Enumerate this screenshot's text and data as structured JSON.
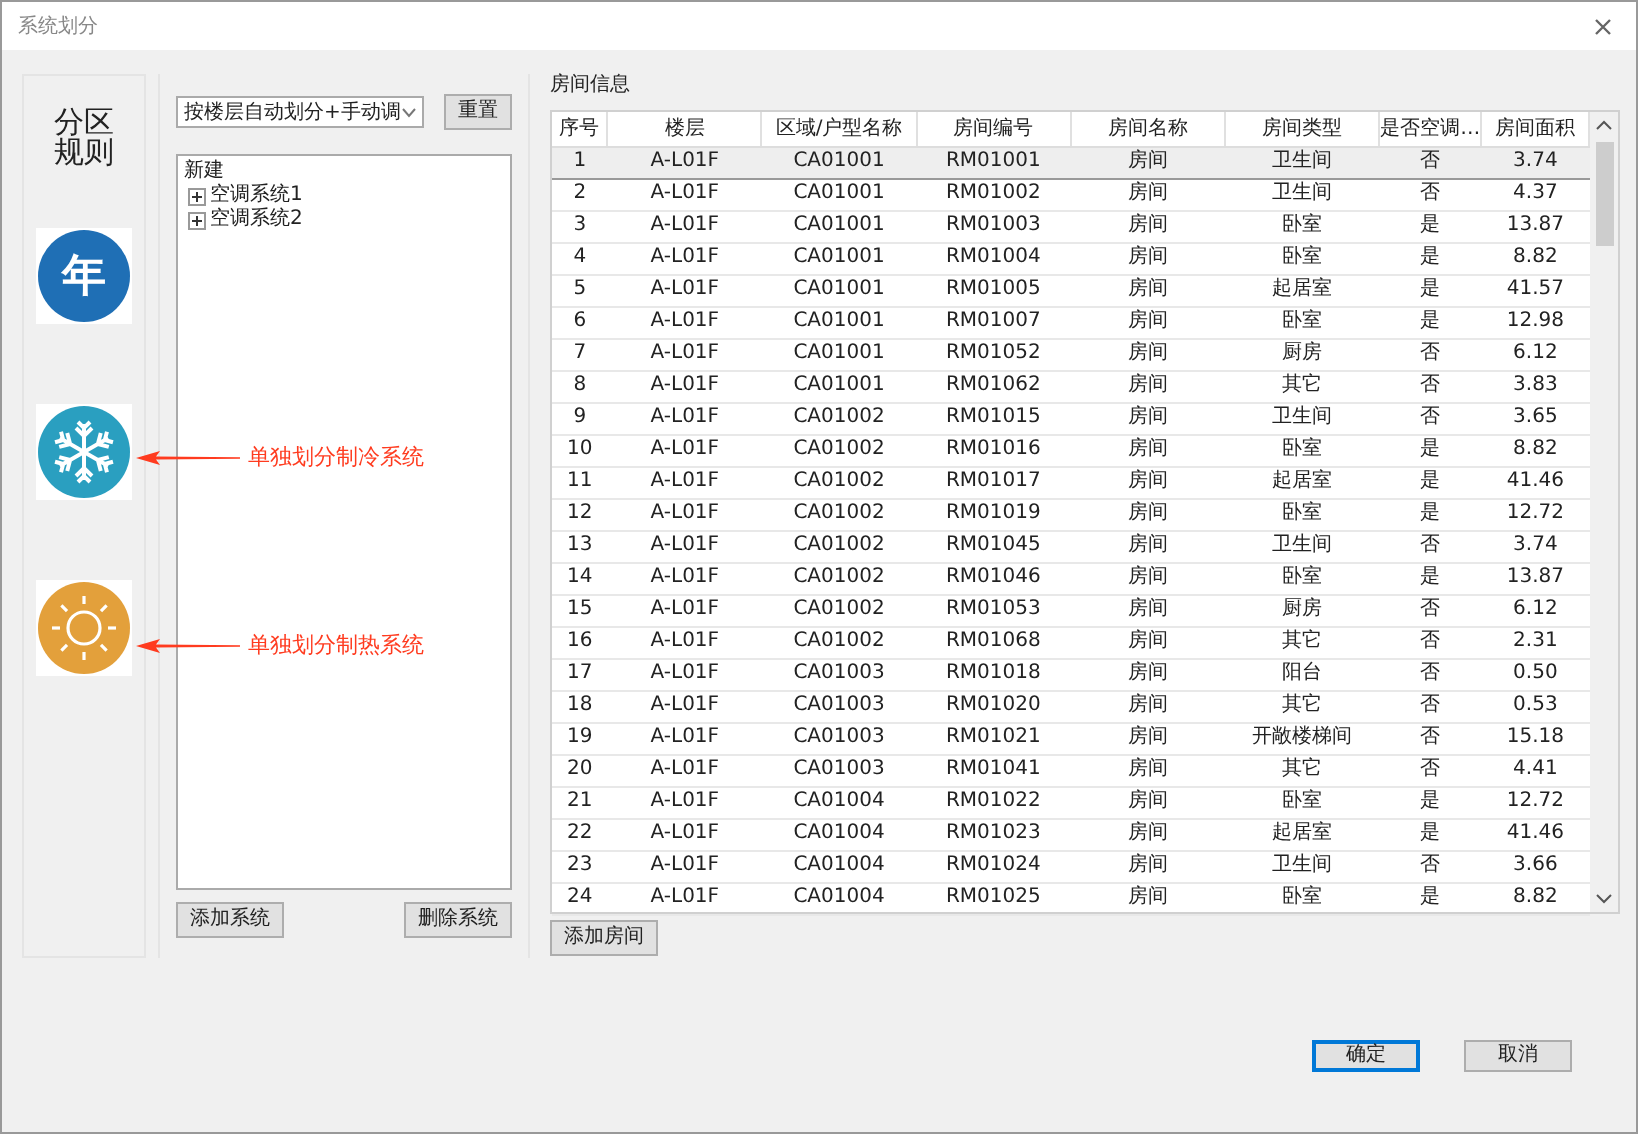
{
  "window": {
    "title": "系统划分"
  },
  "rules": {
    "label": "分区规则",
    "icons": [
      {
        "kind": "year",
        "text": "年",
        "color": "#1f6fb5"
      },
      {
        "kind": "snow",
        "color": "#2a9fc0",
        "note": "单独划分制冷系统"
      },
      {
        "kind": "sun",
        "color": "#e3a03b",
        "note": "单独划分制热系统"
      }
    ]
  },
  "systems": {
    "combo": {
      "value": "按楼层自动划分+手动调"
    },
    "reset": "重置",
    "tree": [
      {
        "label": "新建",
        "children": [
          {
            "label": "空调系统1",
            "expanded": false
          },
          {
            "label": "空调系统2",
            "expanded": false
          }
        ]
      }
    ],
    "buttons": [
      "添加系统",
      "删除系统"
    ]
  },
  "rooms": {
    "title": "房间信息",
    "columns": [
      "序号",
      "楼层",
      "区域/户型名称",
      "房间编号",
      "房间名称",
      "房间类型",
      "是否空调…",
      "房间面积"
    ],
    "rows": [
      {
        "cells": [
          "1",
          "A-L01F",
          "CA01001",
          "RM01001",
          "房间",
          "卫生间",
          "否",
          "3.74"
        ],
        "selected": true
      },
      {
        "cells": [
          "2",
          "A-L01F",
          "CA01001",
          "RM01002",
          "房间",
          "卫生间",
          "否",
          "4.37"
        ],
        "selected": false
      },
      {
        "cells": [
          "3",
          "A-L01F",
          "CA01001",
          "RM01003",
          "房间",
          "卧室",
          "是",
          "13.87"
        ],
        "selected": false
      },
      {
        "cells": [
          "4",
          "A-L01F",
          "CA01001",
          "RM01004",
          "房间",
          "卧室",
          "是",
          "8.82"
        ],
        "selected": false
      },
      {
        "cells": [
          "5",
          "A-L01F",
          "CA01001",
          "RM01005",
          "房间",
          "起居室",
          "是",
          "41.57"
        ],
        "selected": false
      },
      {
        "cells": [
          "6",
          "A-L01F",
          "CA01001",
          "RM01007",
          "房间",
          "卧室",
          "是",
          "12.98"
        ],
        "selected": false
      },
      {
        "cells": [
          "7",
          "A-L01F",
          "CA01001",
          "RM01052",
          "房间",
          "厨房",
          "否",
          "6.12"
        ],
        "selected": false
      },
      {
        "cells": [
          "8",
          "A-L01F",
          "CA01001",
          "RM01062",
          "房间",
          "其它",
          "否",
          "3.83"
        ],
        "selected": false
      },
      {
        "cells": [
          "9",
          "A-L01F",
          "CA01002",
          "RM01015",
          "房间",
          "卫生间",
          "否",
          "3.65"
        ],
        "selected": false
      },
      {
        "cells": [
          "10",
          "A-L01F",
          "CA01002",
          "RM01016",
          "房间",
          "卧室",
          "是",
          "8.82"
        ],
        "selected": false
      },
      {
        "cells": [
          "11",
          "A-L01F",
          "CA01002",
          "RM01017",
          "房间",
          "起居室",
          "是",
          "41.46"
        ],
        "selected": false
      },
      {
        "cells": [
          "12",
          "A-L01F",
          "CA01002",
          "RM01019",
          "房间",
          "卧室",
          "是",
          "12.72"
        ],
        "selected": false
      },
      {
        "cells": [
          "13",
          "A-L01F",
          "CA01002",
          "RM01045",
          "房间",
          "卫生间",
          "否",
          "3.74"
        ],
        "selected": false
      },
      {
        "cells": [
          "14",
          "A-L01F",
          "CA01002",
          "RM01046",
          "房间",
          "卧室",
          "是",
          "13.87"
        ],
        "selected": false
      },
      {
        "cells": [
          "15",
          "A-L01F",
          "CA01002",
          "RM01053",
          "房间",
          "厨房",
          "否",
          "6.12"
        ],
        "selected": false
      },
      {
        "cells": [
          "16",
          "A-L01F",
          "CA01002",
          "RM01068",
          "房间",
          "其它",
          "否",
          "2.31"
        ],
        "selected": false
      },
      {
        "cells": [
          "17",
          "A-L01F",
          "CA01003",
          "RM01018",
          "房间",
          "阳台",
          "否",
          "0.50"
        ],
        "selected": false
      },
      {
        "cells": [
          "18",
          "A-L01F",
          "CA01003",
          "RM01020",
          "房间",
          "其它",
          "否",
          "0.53"
        ],
        "selected": false
      },
      {
        "cells": [
          "19",
          "A-L01F",
          "CA01003",
          "RM01021",
          "房间",
          "开敞楼梯间",
          "否",
          "15.18"
        ],
        "selected": false
      },
      {
        "cells": [
          "20",
          "A-L01F",
          "CA01003",
          "RM01041",
          "房间",
          "其它",
          "否",
          "4.41"
        ],
        "selected": false
      },
      {
        "cells": [
          "21",
          "A-L01F",
          "CA01004",
          "RM01022",
          "房间",
          "卧室",
          "是",
          "12.72"
        ],
        "selected": false
      },
      {
        "cells": [
          "22",
          "A-L01F",
          "CA01004",
          "RM01023",
          "房间",
          "起居室",
          "是",
          "41.46"
        ],
        "selected": false
      },
      {
        "cells": [
          "23",
          "A-L01F",
          "CA01004",
          "RM01024",
          "房间",
          "卫生间",
          "否",
          "3.66"
        ],
        "selected": false
      },
      {
        "cells": [
          "24",
          "A-L01F",
          "CA01004",
          "RM01025",
          "房间",
          "卧室",
          "是",
          "8.82"
        ],
        "selected": false
      }
    ],
    "add": "添加房间"
  },
  "footer": [
    {
      "label": "确定",
      "kind": "default"
    },
    {
      "label": "取消",
      "kind": "normal"
    }
  ]
}
